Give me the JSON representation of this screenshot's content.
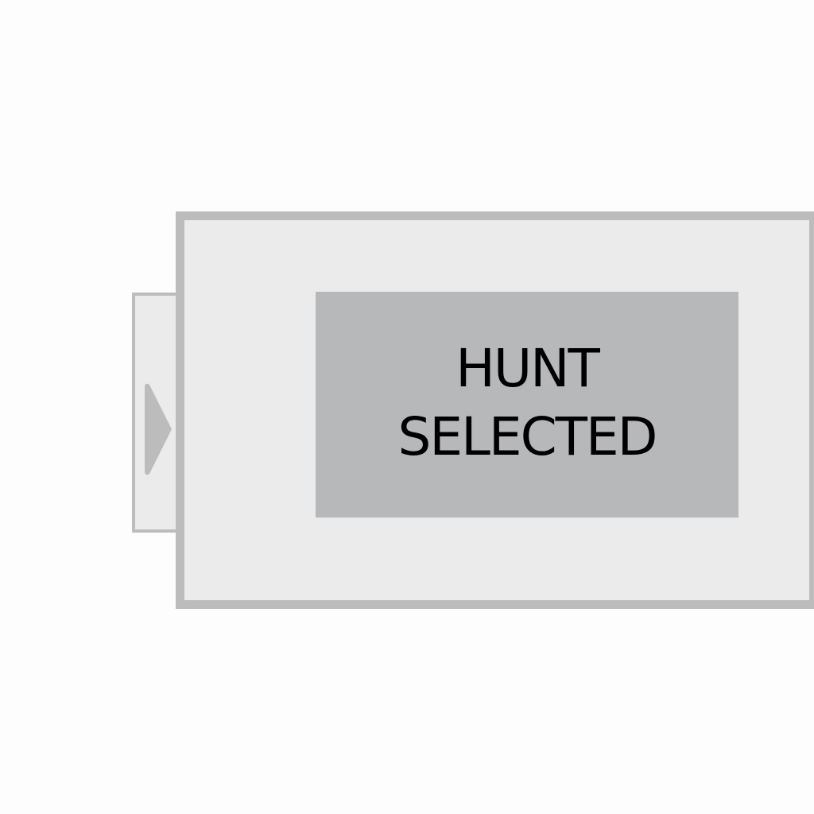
{
  "status": {
    "line1": "HUNT",
    "line2": "SELECTED"
  },
  "colors": {
    "background": "#fdfdfd",
    "panel_fill": "#ebebeb",
    "panel_border": "#bcbcbc",
    "status_fill": "#b7b8ba",
    "text": "#000000"
  },
  "icons": {
    "expand": "chevron-right-icon"
  }
}
